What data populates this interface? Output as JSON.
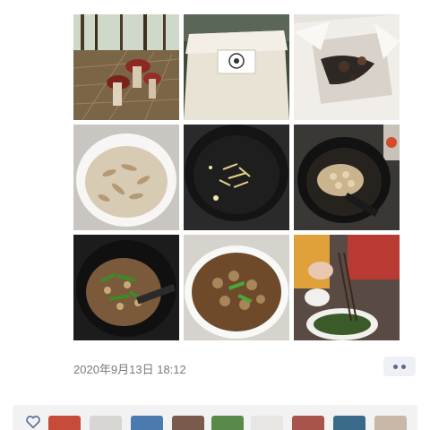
{
  "post": {
    "timestamp": "2020年9月13日 18:12",
    "photos": [
      {
        "name": "mushrooms-in-forest"
      },
      {
        "name": "wrapped-package"
      },
      {
        "name": "dried-mushrooms-in-paper"
      },
      {
        "name": "sliced-mushrooms-in-bowl"
      },
      {
        "name": "ginger-in-wok"
      },
      {
        "name": "mushrooms-frying-in-wok"
      },
      {
        "name": "mushrooms-with-greens-in-wok"
      },
      {
        "name": "finished-mushroom-dish"
      },
      {
        "name": "eating-with-chopsticks"
      }
    ]
  },
  "actions": {
    "more_icon": "ellipsis-icon"
  },
  "likes": {
    "heart_icon": "heart-icon",
    "avatar_count_visible": 9,
    "colors": {
      "heart": "#576b95",
      "bar": "#f2f2f2"
    }
  }
}
